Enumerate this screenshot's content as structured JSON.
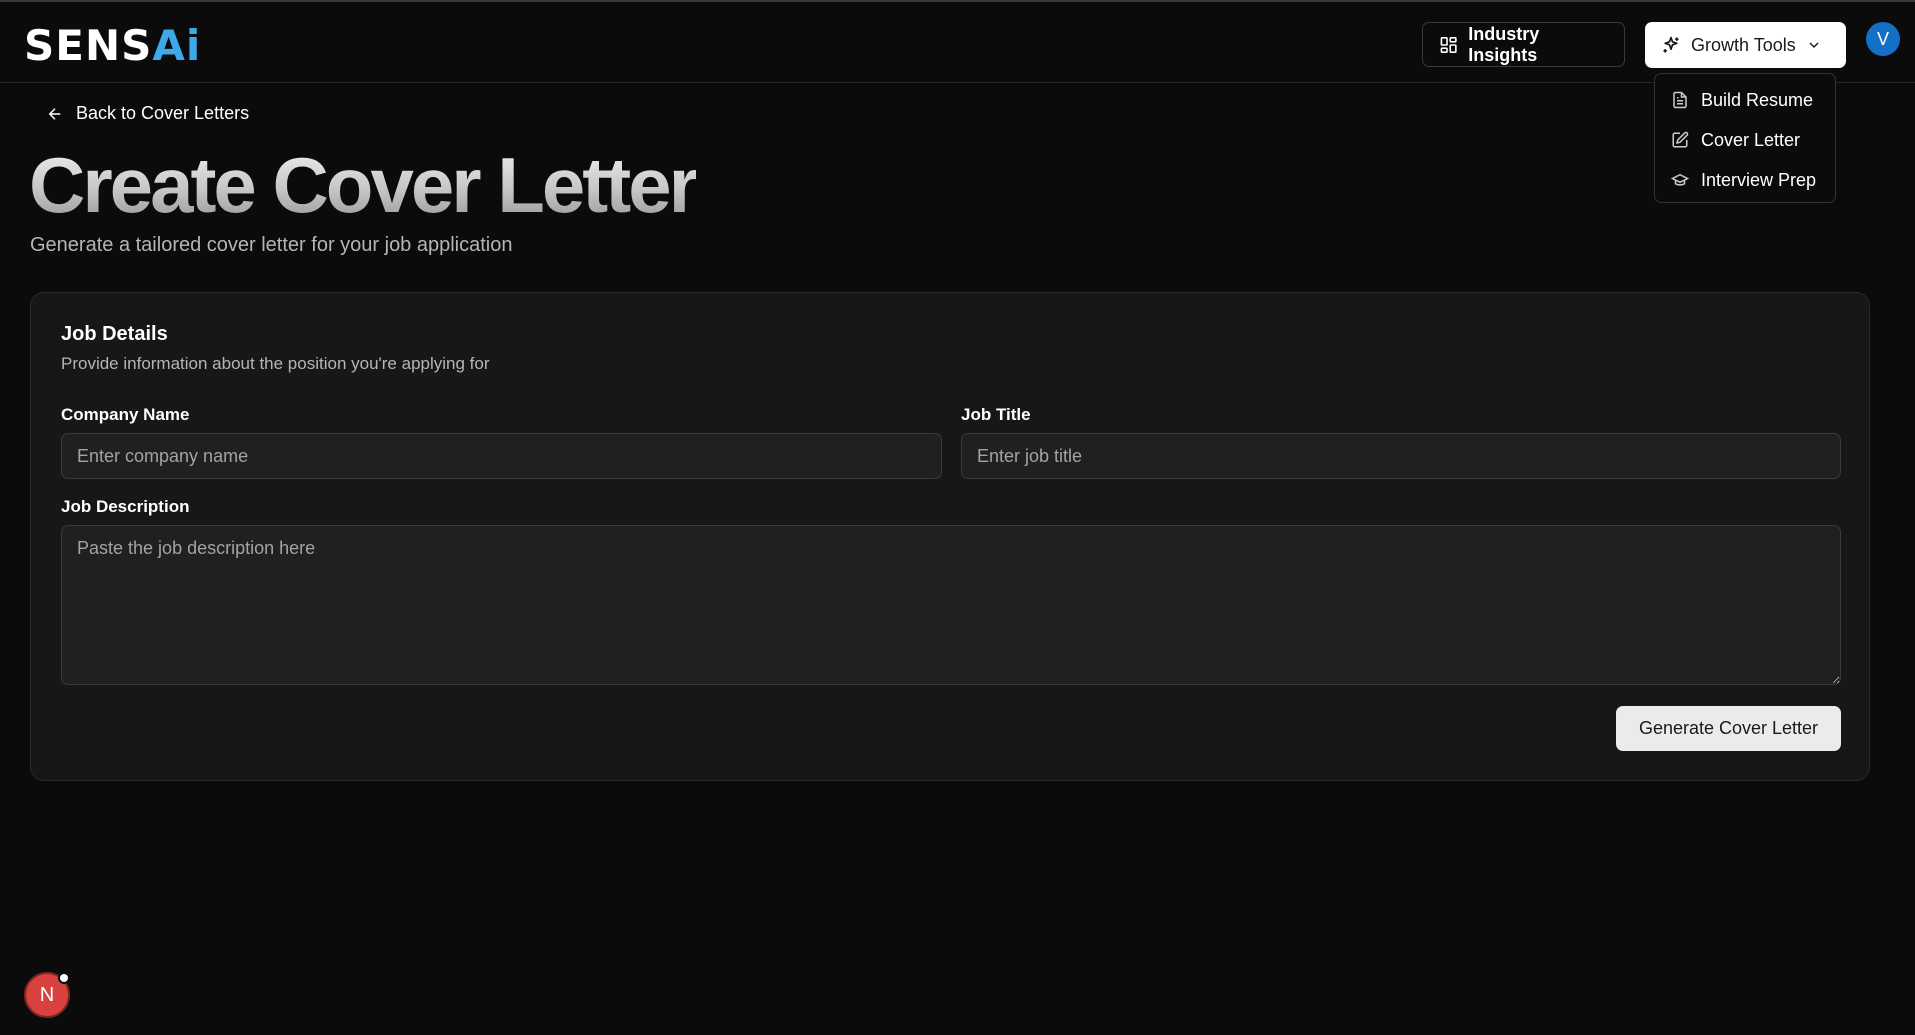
{
  "header": {
    "logo_part1": "SENS",
    "logo_part2": "Ai",
    "industry_insights_label": "Industry Insights",
    "growth_tools_label": "Growth Tools",
    "avatar_initial": "V"
  },
  "growth_menu": {
    "items": [
      {
        "label": "Build Resume",
        "icon": "file-text-icon"
      },
      {
        "label": "Cover Letter",
        "icon": "pen-square-icon"
      },
      {
        "label": "Interview Prep",
        "icon": "graduation-cap-icon"
      }
    ]
  },
  "page": {
    "back_label": "Back to Cover Letters",
    "title": "Create Cover Letter",
    "subtitle": "Generate a tailored cover letter for your job application"
  },
  "form": {
    "title": "Job Details",
    "description": "Provide information about the position you're applying for",
    "company_label": "Company Name",
    "company_placeholder": "Enter company name",
    "job_title_label": "Job Title",
    "job_title_placeholder": "Enter job title",
    "job_description_label": "Job Description",
    "job_description_placeholder": "Paste the job description here",
    "submit_label": "Generate Cover Letter"
  },
  "dev_badge": {
    "letter": "N"
  },
  "colors": {
    "background": "#0b0b0b",
    "card": "#171717",
    "accent_logo": "#3da9e8",
    "avatar": "#1370c6",
    "badge": "#d9413e"
  }
}
